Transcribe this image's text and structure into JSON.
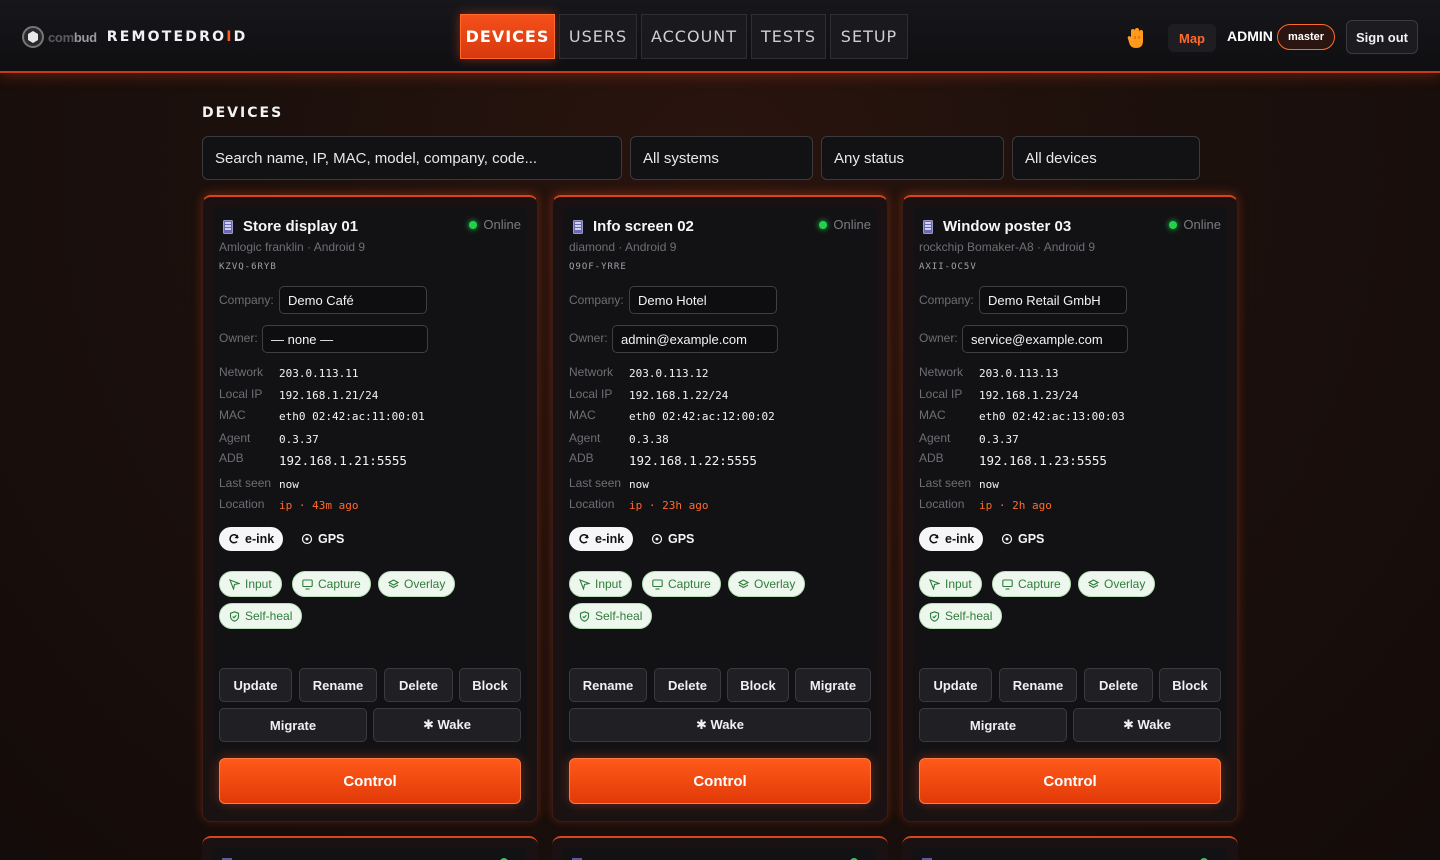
{
  "brand": {
    "sub_dim": "co",
    "sub_mid": "m",
    "sub_bright": "bud",
    "name_pre": "REMOTEDRO",
    "name_hl": "I",
    "name_post": "D"
  },
  "nav": {
    "tabs": [
      {
        "label": "DEVICES",
        "active": true
      },
      {
        "label": "USERS",
        "active": false
      },
      {
        "label": "ACCOUNT",
        "active": false
      },
      {
        "label": "TESTS",
        "active": false
      },
      {
        "label": "SETUP",
        "active": false
      }
    ]
  },
  "header": {
    "map_label": "Map",
    "user_label": "ADMIN",
    "role_badge": "master",
    "signout_label": "Sign out"
  },
  "page": {
    "title": "DEVICES"
  },
  "filters": {
    "search_placeholder": "Search name, IP, MAC, model, company, code...",
    "system": "All systems",
    "status": "Any status",
    "devices": "All devices"
  },
  "labels": {
    "company": "Company:",
    "owner": "Owner:",
    "network": "Network",
    "local_ip": "Local IP",
    "mac": "MAC",
    "agent": "Agent",
    "adb": "ADB",
    "last_seen": "Last seen",
    "location": "Location",
    "eink": "e-ink",
    "gps": "GPS",
    "cap_input": "Input",
    "cap_capture": "Capture",
    "cap_overlay": "Overlay",
    "cap_selfheal": "Self-heal",
    "update": "Update",
    "rename": "Rename",
    "delete": "Delete",
    "block": "Block",
    "migrate": "Migrate",
    "wake": "✱ Wake",
    "control": "Control"
  },
  "colors": {
    "accent": "#ff5a1f",
    "online": "#24d14a",
    "capability_text": "#2f7d3a"
  },
  "devices": [
    {
      "name": "Store display 01",
      "status": "Online",
      "model": "Amlogic franklin · Android 9",
      "code": "KZVQ-6RYB",
      "company": "Demo Café",
      "owner": "— none —",
      "network": "203.0.113.11",
      "local_ip": "192.168.1.21/24",
      "mac": "eth0 02:42:ac:11:00:01",
      "agent": "0.3.37",
      "adb": "192.168.1.21:5555",
      "last_seen": "now",
      "location": "ip · 43m ago"
    },
    {
      "name": "Info screen 02",
      "status": "Online",
      "model": "diamond · Android 9",
      "code": "Q9OF-YRRE",
      "company": "Demo Hotel",
      "owner": "admin@example.com",
      "network": "203.0.113.12",
      "local_ip": "192.168.1.22/24",
      "mac": "eth0 02:42:ac:12:00:02",
      "agent": "0.3.38",
      "adb": "192.168.1.22:5555",
      "last_seen": "now",
      "location": "ip · 23h ago"
    },
    {
      "name": "Window poster 03",
      "status": "Online",
      "model": "rockchip Bomaker-A8 · Android 9",
      "code": "AXII-OC5V",
      "company": "Demo Retail GmbH",
      "owner": "service@example.com",
      "network": "203.0.113.13",
      "local_ip": "192.168.1.23/24",
      "mac": "eth0 02:42:ac:13:00:03",
      "agent": "0.3.37",
      "adb": "192.168.1.23:5555",
      "last_seen": "now",
      "location": "ip · 2h ago"
    }
  ]
}
